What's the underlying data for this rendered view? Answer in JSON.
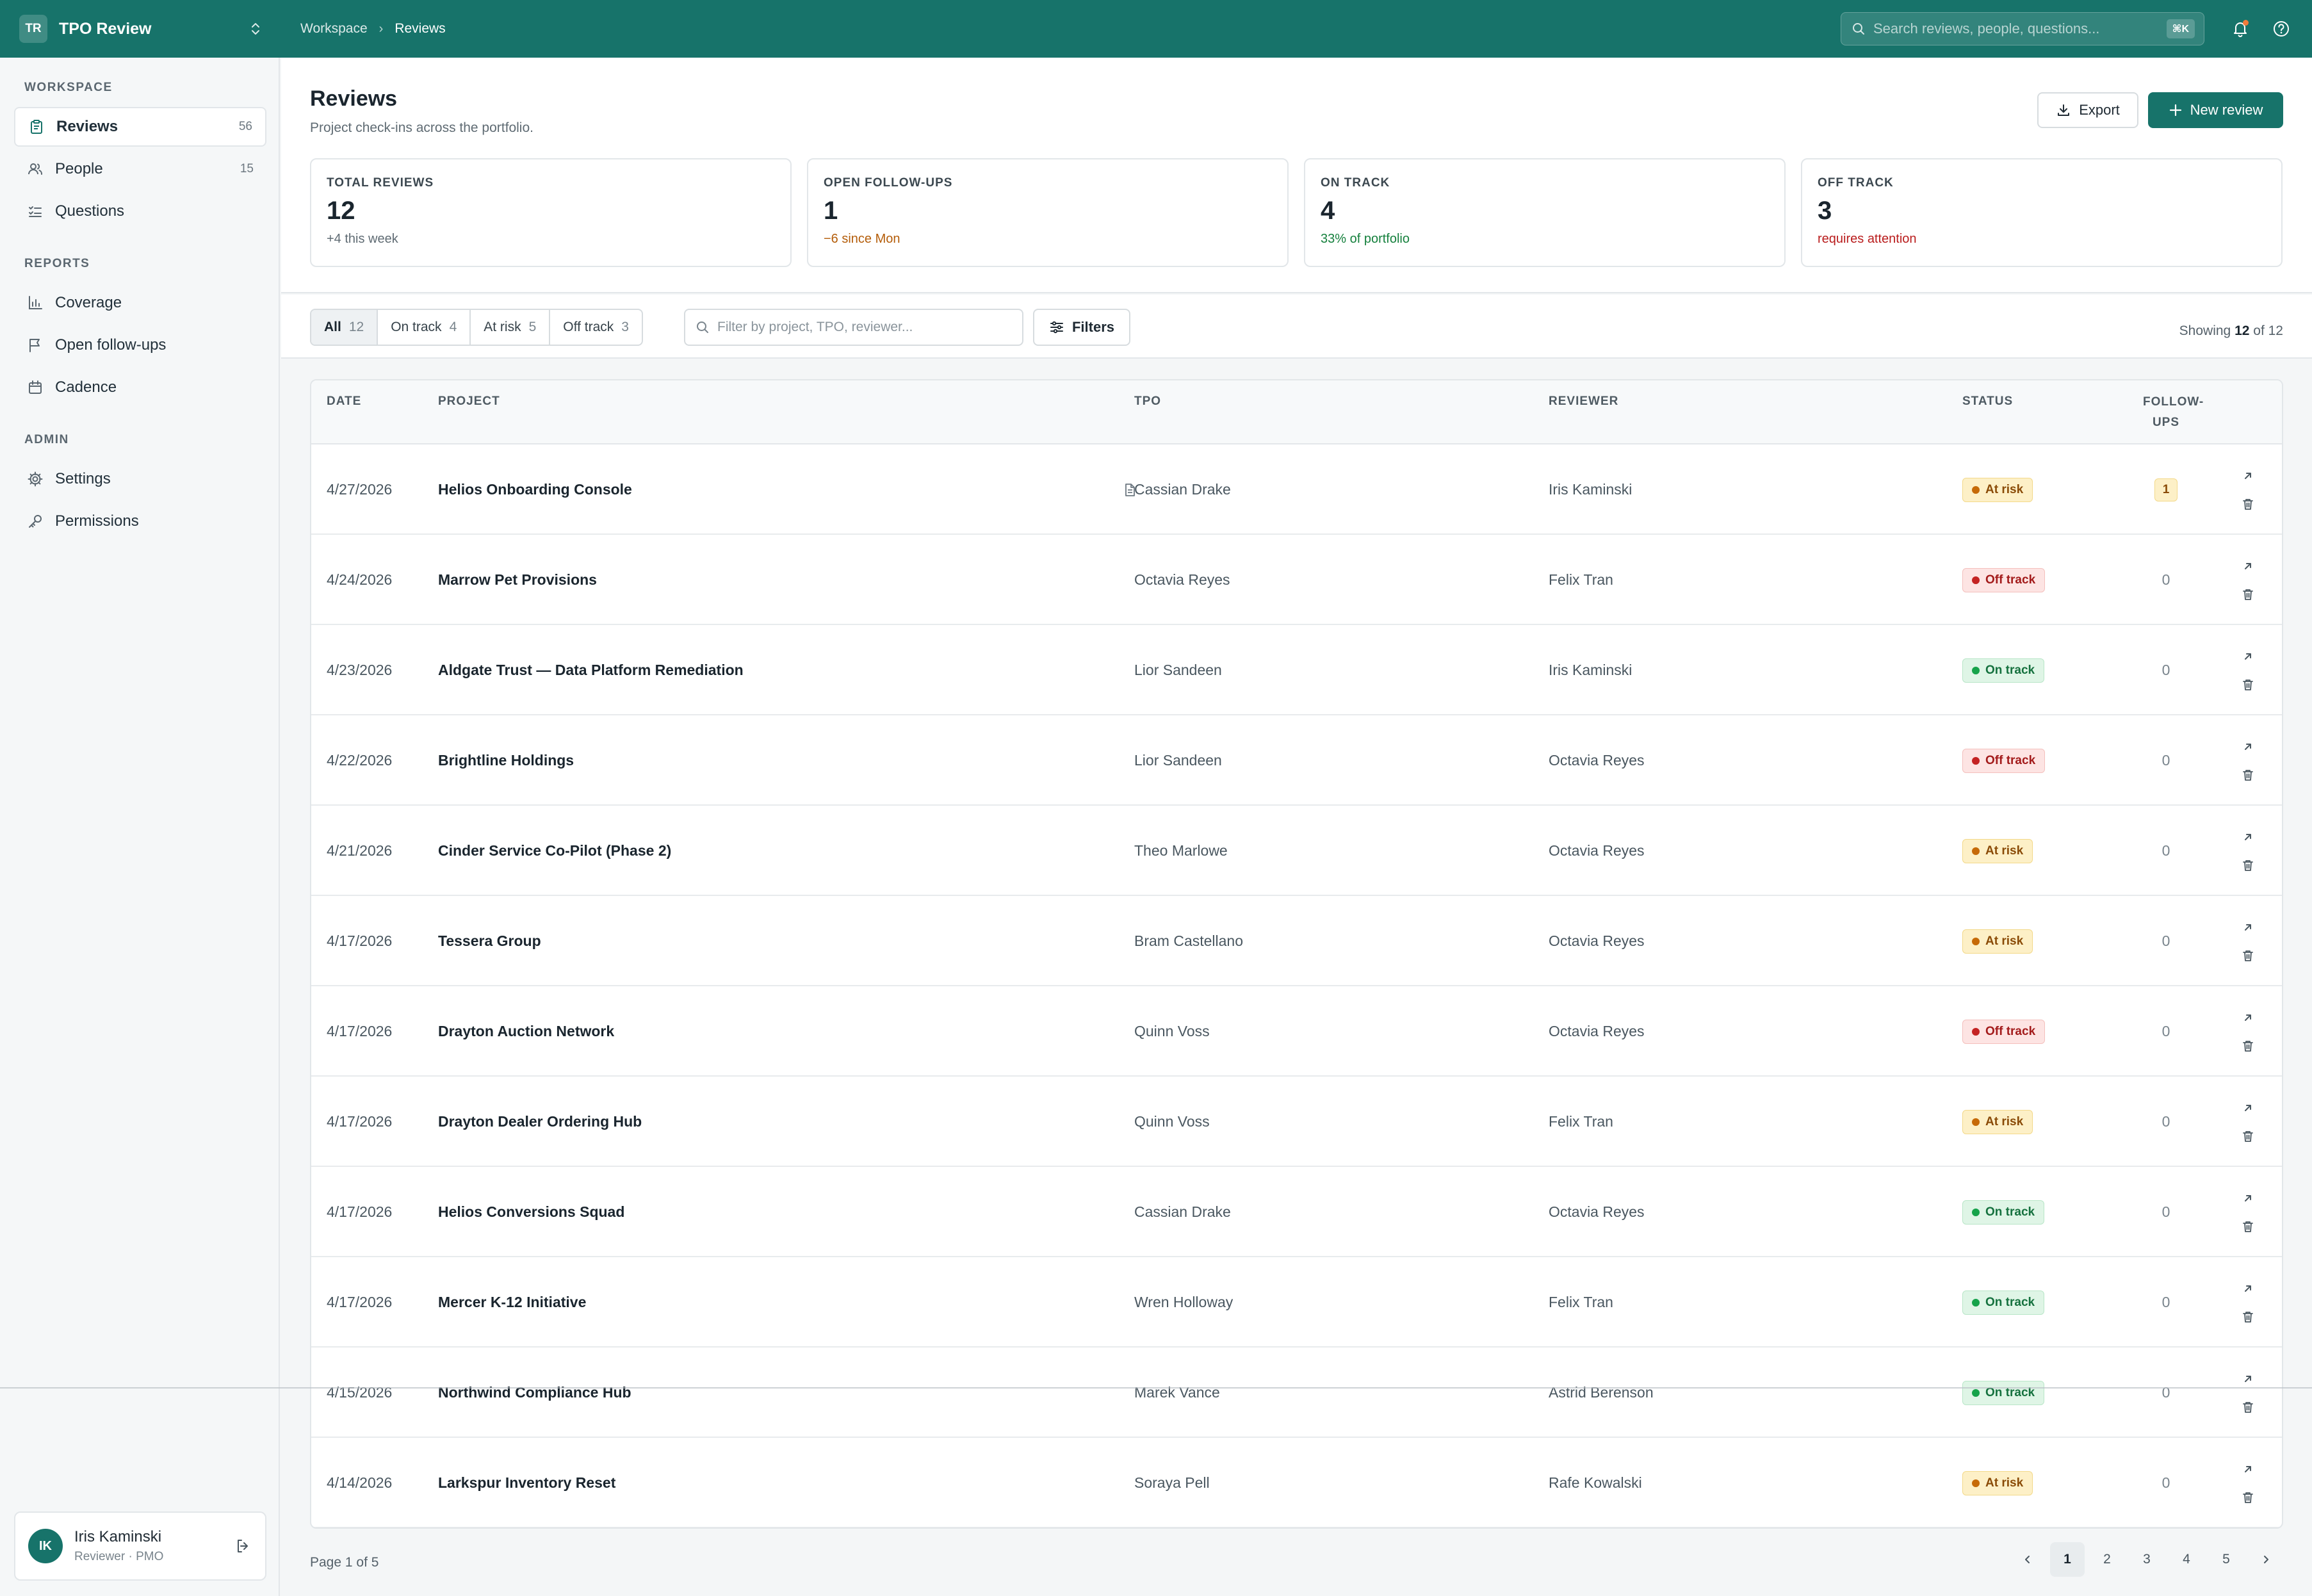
{
  "topbar": {
    "badge": "TR",
    "app_name": "TPO Review",
    "breadcrumb": [
      "Workspace",
      "Reviews"
    ],
    "search_placeholder": "Search reviews, people, questions...",
    "shortcut": "⌘K"
  },
  "sidebar": {
    "sections": [
      {
        "title": "WORKSPACE",
        "items": [
          {
            "label": "Reviews",
            "count": "56",
            "icon": "clipboard-icon",
            "active": true
          },
          {
            "label": "People",
            "count": "15",
            "icon": "people-icon"
          },
          {
            "label": "Questions",
            "count": "",
            "icon": "checklist-icon"
          }
        ]
      },
      {
        "title": "REPORTS",
        "items": [
          {
            "label": "Coverage",
            "count": "",
            "icon": "bar-chart-icon"
          },
          {
            "label": "Open follow-ups",
            "count": "",
            "icon": "flag-icon"
          },
          {
            "label": "Cadence",
            "count": "",
            "icon": "calendar-icon"
          }
        ]
      },
      {
        "title": "ADMIN",
        "items": [
          {
            "label": "Settings",
            "count": "",
            "icon": "gear-icon"
          },
          {
            "label": "Permissions",
            "count": "",
            "icon": "key-icon"
          }
        ]
      }
    ],
    "user": {
      "initials": "IK",
      "name": "Iris Kaminski",
      "role": "Reviewer · PMO"
    }
  },
  "page": {
    "title": "Reviews",
    "subtitle": "Project check-ins across the portfolio.",
    "export_label": "Export",
    "new_label": "New review"
  },
  "stats": [
    {
      "label": "TOTAL REVIEWS",
      "value": "12",
      "note": "+4 this week",
      "note_color": "#5f6b73"
    },
    {
      "label": "OPEN FOLLOW-UPS",
      "value": "1",
      "note": "−6 since Mon",
      "note_color": "#b45d0a"
    },
    {
      "label": "ON TRACK",
      "value": "4",
      "note": "33% of portfolio",
      "note_color": "#15803d"
    },
    {
      "label": "OFF TRACK",
      "value": "3",
      "note": "requires attention",
      "note_color": "#b91c1c"
    }
  ],
  "filters": {
    "segments": [
      {
        "label": "All",
        "count": "12"
      },
      {
        "label": "On track",
        "count": "4"
      },
      {
        "label": "At risk",
        "count": "5"
      },
      {
        "label": "Off track",
        "count": "3"
      }
    ],
    "placeholder": "Filter by project, TPO, reviewer...",
    "filters_label": "Filters",
    "showing_prefix": "Showing",
    "showing_count": "12",
    "showing_suffix": "of 12"
  },
  "table": {
    "headers": {
      "date": "DATE",
      "project": "PROJECT",
      "tpo": "TPO",
      "reviewer": "REVIEWER",
      "status": "STATUS",
      "followups_1": "FOLLOW-",
      "followups_2": "UPS"
    },
    "rows": [
      {
        "date": "4/27/2026",
        "project": "Helios Onboarding Console",
        "has_note": true,
        "tpo": "Cassian Drake",
        "reviewer": "Iris Kaminski",
        "status": "At risk",
        "followups": "1"
      },
      {
        "date": "4/24/2026",
        "project": "Marrow Pet Provisions",
        "tpo": "Octavia Reyes",
        "reviewer": "Felix Tran",
        "status": "Off track",
        "followups": "0"
      },
      {
        "date": "4/23/2026",
        "project": "Aldgate Trust — Data Platform Remediation",
        "tpo": "Lior Sandeen",
        "reviewer": "Iris Kaminski",
        "status": "On track",
        "followups": "0"
      },
      {
        "date": "4/22/2026",
        "project": "Brightline Holdings",
        "tpo": "Lior Sandeen",
        "reviewer": "Octavia Reyes",
        "status": "Off track",
        "followups": "0"
      },
      {
        "date": "4/21/2026",
        "project": "Cinder Service Co-Pilot (Phase 2)",
        "tpo": "Theo Marlowe",
        "reviewer": "Octavia Reyes",
        "status": "At risk",
        "followups": "0"
      },
      {
        "date": "4/17/2026",
        "project": "Tessera Group",
        "tpo": "Bram Castellano",
        "reviewer": "Octavia Reyes",
        "status": "At risk",
        "followups": "0"
      },
      {
        "date": "4/17/2026",
        "project": "Drayton Auction Network",
        "tpo": "Quinn Voss",
        "reviewer": "Octavia Reyes",
        "status": "Off track",
        "followups": "0"
      },
      {
        "date": "4/17/2026",
        "project": "Drayton Dealer Ordering Hub",
        "tpo": "Quinn Voss",
        "reviewer": "Felix Tran",
        "status": "At risk",
        "followups": "0"
      },
      {
        "date": "4/17/2026",
        "project": "Helios Conversions Squad",
        "tpo": "Cassian Drake",
        "reviewer": "Octavia Reyes",
        "status": "On track",
        "followups": "0"
      },
      {
        "date": "4/17/2026",
        "project": "Mercer K-12 Initiative",
        "tpo": "Wren Holloway",
        "reviewer": "Felix Tran",
        "status": "On track",
        "followups": "0"
      },
      {
        "date": "4/15/2026",
        "project": "Northwind Compliance Hub",
        "tpo": "Marek Vance",
        "reviewer": "Astrid Berenson",
        "status": "On track",
        "followups": "0"
      },
      {
        "date": "4/14/2026",
        "project": "Larkspur Inventory Reset",
        "tpo": "Soraya Pell",
        "reviewer": "Rafe Kowalski",
        "status": "At risk",
        "followups": "0"
      }
    ]
  },
  "pagination": {
    "label": "Page 1 of 5",
    "pages": [
      "1",
      "2",
      "3",
      "4",
      "5"
    ],
    "current": "1"
  }
}
